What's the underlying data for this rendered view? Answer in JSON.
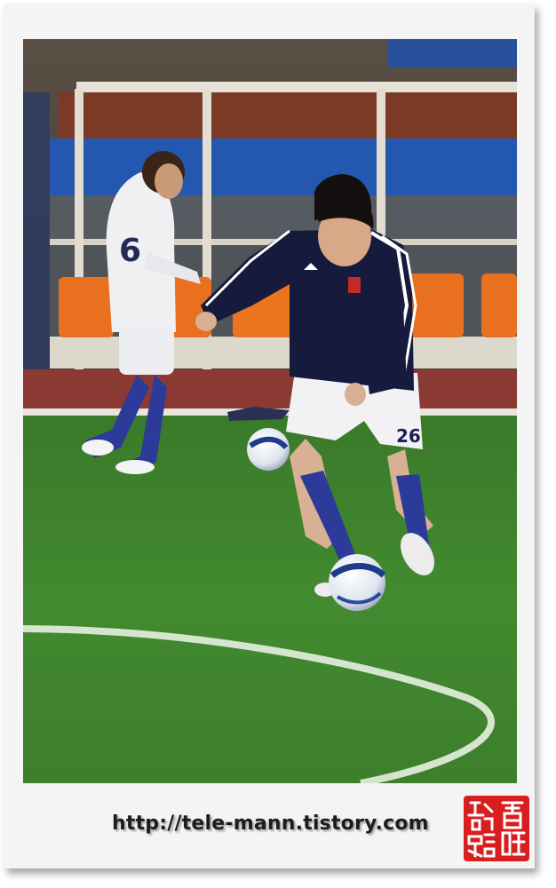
{
  "photo": {
    "subject": "soccer-warmup-scene",
    "jersey_number": "26",
    "background_jersey_number": "6"
  },
  "caption": {
    "url_text": "http://tele-mann.tistory.com"
  },
  "seal": {
    "characters": [
      "首",
      "睛",
      "難",
      "路"
    ],
    "color": "#d81e1e"
  },
  "colors": {
    "pitch": "#3f7f2c",
    "track": "#8b3a33",
    "kit_navy": "#161a3c",
    "bench_seat": "#e9701f",
    "frame": "#f4f4f4"
  }
}
